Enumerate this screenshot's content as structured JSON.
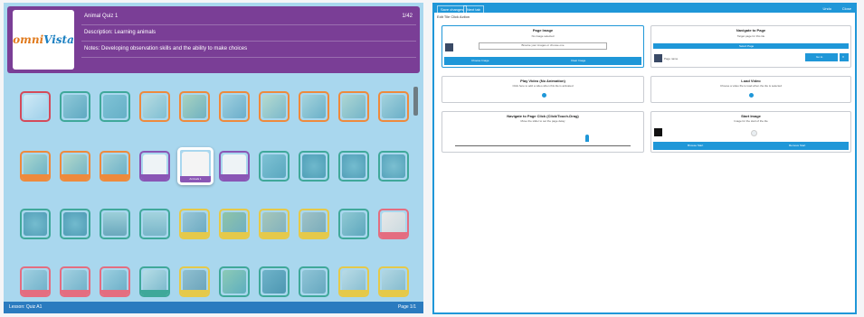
{
  "left": {
    "logo": {
      "part1": "omni",
      "part2": "Vista"
    },
    "header": {
      "title": "Animal Quiz 1",
      "counter": "1/42",
      "description": "Description: Learning animals",
      "notes": "Notes: Developing observation skills and the ability to make choices"
    },
    "selected_tile_caption": "Animals 1",
    "footer": {
      "left": "Lesson: Quiz A1",
      "right": "Page 1/1"
    }
  },
  "right": {
    "topbar": {
      "btn1": "Save changes",
      "btn2": "Next tab",
      "right1": "Undo",
      "right2": "Close"
    },
    "subtitle": "Edit Tile Click Action",
    "cards": {
      "page_image": {
        "title": "Page Image",
        "line1": "No image selected",
        "line2": "Browse your images or choose one",
        "btn1": "Choose Image",
        "btn2": "Clear Image"
      },
      "navigate": {
        "title": "Navigate to Page",
        "line1": "Target page for this tile",
        "btn": "Select Page",
        "field": "Page name",
        "btn2": "Go to",
        "btn3": "X"
      },
      "play_video": {
        "title": "Play Video (No Animation)",
        "line1": "Click here to add a video when this tile is activated"
      },
      "load_video": {
        "title": "Load Video",
        "line1": "Choose a video file to load when the tile is selected"
      },
      "navigate_slider": {
        "title": "Navigate to Page Click (Click/Touch-Drag)",
        "line1": "Move the slider to set the page delay"
      },
      "start_image": {
        "title": "Start Image",
        "line1": "Image for the start of the tile",
        "btn1": "Browse Start",
        "btn2": "Remove Start"
      }
    }
  },
  "colors": {
    "purple": "#7a3e96",
    "sky": "#a9d7ee",
    "blue": "#1f97d8"
  }
}
